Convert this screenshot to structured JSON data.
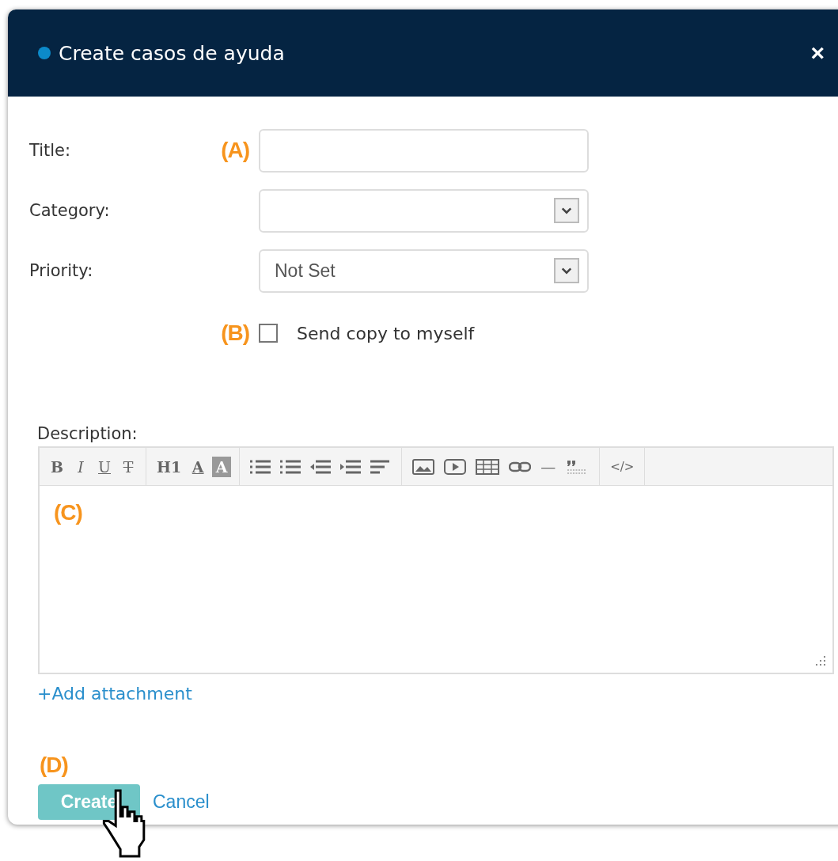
{
  "dialog": {
    "title": "Create casos de ayuda",
    "close": "×"
  },
  "fields": [
    {
      "kind": "text",
      "label": "Title:",
      "marker": "(A)"
    },
    {
      "kind": "select",
      "label": "Category:"
    },
    {
      "kind": "select",
      "label": "Priority:",
      "value": "Not Set"
    }
  ],
  "checkbox": {
    "marker": "(B)",
    "label": "Send copy to myself",
    "checked": false
  },
  "description": {
    "label": "Description:",
    "marker": "(C)",
    "toolbar": [
      [
        {
          "kind": "bold",
          "text": "B"
        },
        {
          "kind": "italic",
          "text": "I"
        },
        {
          "kind": "underline",
          "text": "U"
        },
        {
          "kind": "strike",
          "text": "T"
        }
      ],
      [
        {
          "kind": "heading",
          "text": "H1"
        },
        {
          "kind": "font-color",
          "text": "A"
        },
        {
          "kind": "bg-color",
          "text": "A"
        }
      ],
      [
        {
          "kind": "bullet-list"
        },
        {
          "kind": "numbered-list"
        },
        {
          "kind": "outdent"
        },
        {
          "kind": "indent"
        },
        {
          "kind": "align"
        }
      ],
      [
        {
          "kind": "image"
        },
        {
          "kind": "video"
        },
        {
          "kind": "table"
        },
        {
          "kind": "link"
        },
        {
          "kind": "rule",
          "text": "—"
        },
        {
          "kind": "quote"
        }
      ],
      [
        {
          "kind": "code",
          "text": "</>"
        }
      ]
    ]
  },
  "attachment": "+Add attachment",
  "actions": {
    "marker": "(D)",
    "create": "Create",
    "cancel": "Cancel"
  }
}
